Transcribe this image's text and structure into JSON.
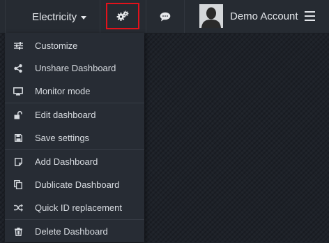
{
  "topbar": {
    "dataset_label": "Electricity",
    "account_name": "Demo Account"
  },
  "dropdown": {
    "groups": [
      [
        {
          "label": "Customize",
          "icon": "sliders-icon"
        },
        {
          "label": "Unshare Dashboard",
          "icon": "share-icon"
        },
        {
          "label": "Monitor mode",
          "icon": "monitor-icon"
        }
      ],
      [
        {
          "label": "Edit dashboard",
          "icon": "unlock-icon"
        },
        {
          "label": "Save settings",
          "icon": "floppy-icon"
        }
      ],
      [
        {
          "label": "Add Dashboard",
          "icon": "add-page-icon"
        },
        {
          "label": "Dublicate Dashboard",
          "icon": "copy-icon"
        },
        {
          "label": "Quick ID replacement",
          "icon": "shuffle-icon"
        }
      ],
      [
        {
          "label": "Delete Dashboard",
          "icon": "trash-icon"
        }
      ]
    ]
  },
  "colors": {
    "topbar_bg": "#262b32",
    "dropdown_bg": "#272c34",
    "highlight_border": "#e3121b",
    "text": "#dfe3e8"
  }
}
